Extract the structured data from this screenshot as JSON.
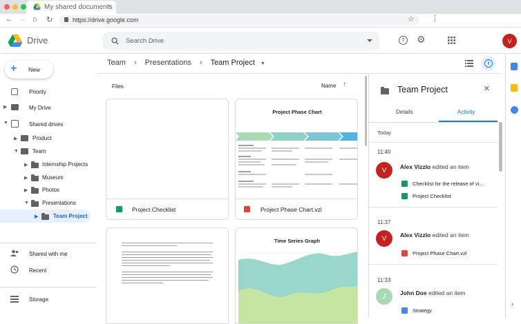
{
  "browser": {
    "tab_title": "My shared documents",
    "url": "https://drive.google.com"
  },
  "app": {
    "name": "Drive",
    "search_placeholder": "Search Drive",
    "avatar_letter": "V"
  },
  "sidebar": {
    "new_label": "New",
    "items": [
      {
        "label": "Priority",
        "icon": "priority-icon"
      },
      {
        "label": "My Drive",
        "icon": "my-drive-icon"
      },
      {
        "label": "Shared drives",
        "icon": "shared-drives-icon"
      }
    ],
    "tree": [
      {
        "label": "Product"
      },
      {
        "label": "Team"
      },
      {
        "label": "Internship Projects"
      },
      {
        "label": "Museum"
      },
      {
        "label": "Photos"
      },
      {
        "label": "Presentations"
      },
      {
        "label": "Team Project"
      }
    ],
    "bottom": [
      {
        "label": "Shared with me"
      },
      {
        "label": "Recent"
      },
      {
        "label": "Storage"
      }
    ]
  },
  "breadcrumb": [
    "Team",
    "Presentations",
    "Team Project"
  ],
  "files": {
    "section_label": "Files",
    "sort_label": "Name",
    "items": [
      {
        "name": "Project Checklist",
        "type": "sheet"
      },
      {
        "name": "Project Phase Chart.vzl",
        "type": "image"
      },
      {
        "name": "",
        "type": "doc"
      },
      {
        "name": "",
        "type": "graph"
      }
    ],
    "phase_chart_title": "Project Phase Chart",
    "time_series_title": "Time Series Graph"
  },
  "details": {
    "title": "Team Project",
    "tabs": [
      "Details",
      "Activity"
    ],
    "active_tab": "Activity",
    "today_label": "Today",
    "entries": [
      {
        "time": "11:40",
        "avatar": "V",
        "user": "Alex Vizzlo",
        "action": "edited an item",
        "files": [
          {
            "name": "Checklist for the release of vi...",
            "type": "sheet"
          },
          {
            "name": "Project Checklist",
            "type": "sheet"
          }
        ]
      },
      {
        "time": "11:37",
        "avatar": "V",
        "user": "Alex Vizzlo",
        "action": "edited an item",
        "files": [
          {
            "name": "Project Phase Chart.vzl",
            "type": "image"
          }
        ]
      },
      {
        "time": "11:33",
        "avatar": "J",
        "user": "John Doe",
        "action": "edited an item",
        "files": [
          {
            "name": "Strategy",
            "type": "doc"
          }
        ]
      }
    ]
  },
  "colors": {
    "brand_blue": "#1a73e8",
    "avatar_red": "#c5221f",
    "avatar_green": "#a8dab5",
    "sheet_green": "#0f9d58",
    "image_red": "#ea4335",
    "doc_blue": "#4285f4"
  }
}
